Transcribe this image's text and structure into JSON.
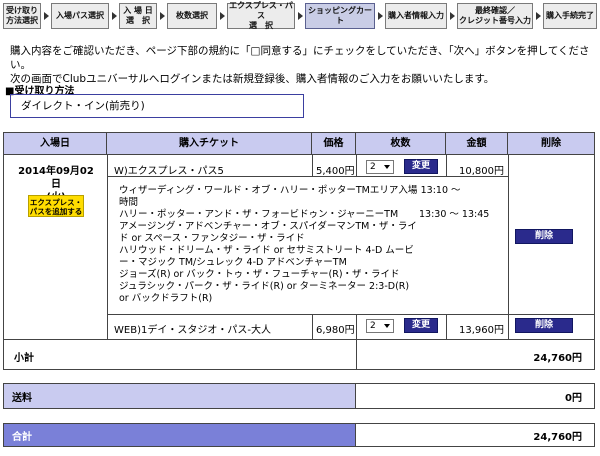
{
  "steps": [
    {
      "label": "受け取り\n方法選択"
    },
    {
      "label": "入場パス選択"
    },
    {
      "label": "入 場 日\n選　択"
    },
    {
      "label": "枚数選択"
    },
    {
      "label": "エクスプレス・パス\n選　択"
    },
    {
      "label": "ショッピングカート"
    },
    {
      "label": "購入者情報入力"
    },
    {
      "label": "最終確認／\nクレジット番号入力"
    },
    {
      "label": "購入手続完了"
    }
  ],
  "intro": {
    "line1": "購入内容をご確認いただき、ページ下部の規約に「□同意する」にチェックをしていただき、「次へ」ボタンを押してください。",
    "line2": "次の画面でClubユニバーサルへログインまたは新規登録後、購入者情報のご入力をお願いいたします。"
  },
  "receive": {
    "title": "■受け取り方法",
    "value": "ダイレクト・イン(前売り)"
  },
  "table": {
    "headers": {
      "date": "入場日",
      "ticket": "購入チケット",
      "price": "価格",
      "qty": "枚数",
      "amount": "金額",
      "delete": "削除"
    },
    "date_line1": "2014年09月02日",
    "date_line2": "(火)",
    "add_pass_label": "エクスプレス・\nパスを追加する",
    "rows": [
      {
        "ticket": "W)エクスプレス・パス5",
        "price": "5,400円",
        "qty": "2",
        "change": "変更",
        "amount": "10,800円",
        "delete": "削除"
      },
      {
        "ticket": "WEB)1デイ・スタジオ・パス-大人",
        "price": "6,980円",
        "qty": "2",
        "change": "変更",
        "amount": "13,960円",
        "delete": "削除"
      }
    ],
    "attractions": [
      {
        "name": "ウィザーディング・ワールド・オブ・ハリー・ポッターTMエリア入場時間",
        "time": "13:10 ～"
      },
      {
        "name": "ハリー・ポッター・アンド・ザ・フォービドゥン・ジャーニーTM",
        "time": "13:30 ～ 13:45"
      },
      {
        "name": "アメージング・アドベンチャー・オブ・スパイダーマンTM・ザ・ライド or スペース・ファンタジー・ザ・ライド",
        "time": ""
      },
      {
        "name": "ハリウッド・ドリーム・ザ・ライド or セサミストリート 4-D ムービー・マジック TM/シュレック 4-D アドベンチャーTM",
        "time": ""
      },
      {
        "name": "ジョーズ(R) or バック・トゥ・ザ・フューチャー(R)・ザ・ライド",
        "time": ""
      },
      {
        "name": "ジュラシック・パーク・ザ・ライド(R) or ターミネーター 2:3-D(R) or バックドラフト(R)",
        "time": ""
      }
    ]
  },
  "subtotal": {
    "label": "小計",
    "value": "24,760円"
  },
  "postage": {
    "label": "送料",
    "value": "0円"
  },
  "total": {
    "label": "合計",
    "value": "24,760円"
  },
  "colors": {
    "header_bg": "#c9cbf0",
    "total_bg": "#7a80d8",
    "button_bg": "#2a2a8c",
    "add_pass_bg": "#ffdd00"
  }
}
